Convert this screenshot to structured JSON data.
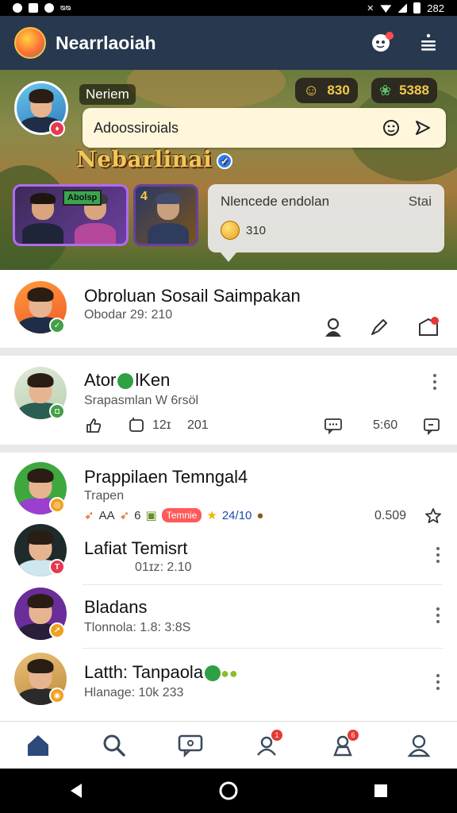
{
  "status_bar": {
    "left_text": "ᴓᴓ",
    "time": "282"
  },
  "app_bar": {
    "title": "Nearrlaoiah"
  },
  "hero": {
    "username": "Neriem",
    "coins": [
      {
        "value": "830",
        "icon": "smile-coin-icon"
      },
      {
        "value": "5388",
        "icon": "leaf-gem-icon"
      }
    ],
    "search_value": "Adoossiroials",
    "title": "Nebarlinai",
    "message": {
      "title": "Nlencede endolan",
      "action": "Stai",
      "coin_value": "310"
    },
    "sign_text": "Abolsp"
  },
  "feed": {
    "featured": {
      "title": "Obroluan Sosail Saimpakan",
      "subtitle": "Obodar 29: 210"
    },
    "card": {
      "title_part1": "Ator",
      "title_part2": "lKen",
      "subtitle": "Srapasmlan W 6rsöl",
      "likes": "",
      "comments": "12ɪ",
      "shares": "201",
      "views": "5:60"
    },
    "items": [
      {
        "title": "Prappilaen Temngal4",
        "subtitle": "Trapen",
        "tags": [
          "AA",
          "6",
          "Temnie",
          "24/10"
        ],
        "value": "0.509"
      },
      {
        "title": "Lafiat Temisrt",
        "subtitle": "01ɪz: 2.10"
      },
      {
        "title": "Bladans",
        "subtitle": "Tlonnola: 1.8: 3:8S"
      },
      {
        "title": "Latth: Tanpaola",
        "subtitle": "Hlanage: 10k 233"
      }
    ]
  },
  "bottom_nav": [
    {
      "name": "home",
      "badge": ""
    },
    {
      "name": "search",
      "badge": ""
    },
    {
      "name": "messages",
      "badge": ""
    },
    {
      "name": "notifications",
      "badge": "1"
    },
    {
      "name": "alerts",
      "badge": "6"
    },
    {
      "name": "profile",
      "badge": ""
    }
  ],
  "colors": {
    "app_bar": "#27384f",
    "accent": "#2d4a7a",
    "badge_red": "#e53935",
    "verified_blue": "#2d7ff9"
  }
}
